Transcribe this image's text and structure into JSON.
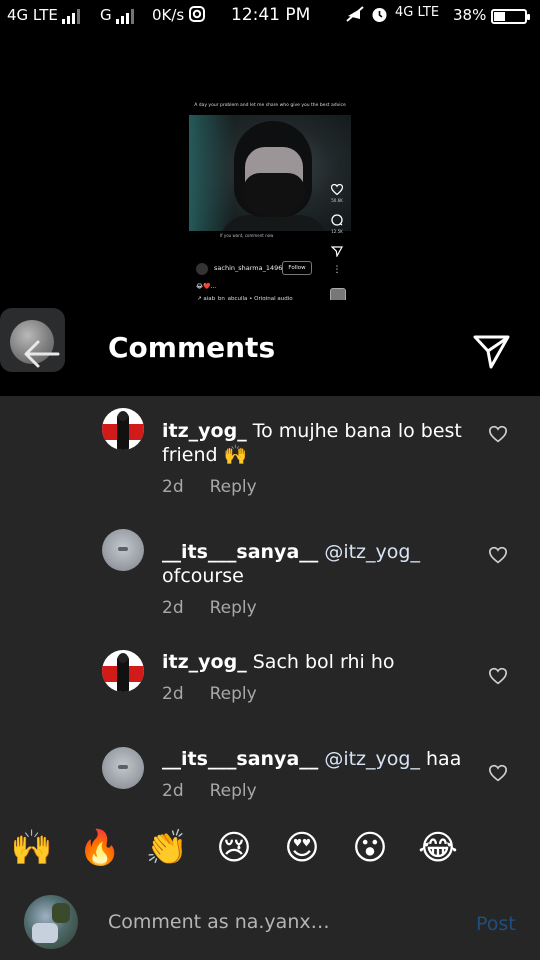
{
  "status_bar": {
    "network_left": "4G LTE",
    "network_g": "G",
    "speed": "0K/s",
    "time": "12:41 PM",
    "network_right": "4G LTE",
    "battery_percent": "38%",
    "battery_level": 0.38
  },
  "reel": {
    "caption_top": "A day your problem and let me share who give you the best advice",
    "subtitle": "If you want, comment now",
    "like_count": "50.6K",
    "comment_count": "12.5K",
    "username": "sachin_sharma_1496",
    "follow_label": "Follow",
    "emoji_line": "😂❤️...",
    "audio_line": "↗ ajab_bn_abculla • Original audio"
  },
  "header": {
    "title": "Comments"
  },
  "comments": [
    {
      "username": "itz_yog_",
      "mention": "",
      "text": "To mujhe bana lo best friend 🙌",
      "time": "2d",
      "reply_label": "Reply",
      "avatar": "yog"
    },
    {
      "username": "__its___sanya__",
      "mention": "@itz_yog_",
      "text": "ofcourse",
      "time": "2d",
      "reply_label": "Reply",
      "avatar": "sanya"
    },
    {
      "username": "itz_yog_",
      "mention": "",
      "text": "Sach bol rhi ho",
      "time": "2d",
      "reply_label": "Reply",
      "avatar": "yog"
    },
    {
      "username": "__its___sanya__",
      "mention": "@itz_yog_",
      "text": "haa",
      "time": "2d",
      "reply_label": "Reply",
      "avatar": "sanya"
    }
  ],
  "emoji_bar": [
    "🙌",
    "🔥",
    "👏",
    "😢",
    "😍",
    "😮",
    "😂"
  ],
  "composer": {
    "placeholder": "Comment as na.yanx…",
    "post_label": "Post"
  },
  "colors": {
    "background": "#000000",
    "sheet": "#262626",
    "meta_text": "#a8a8a8",
    "post_disabled": "#1f4f7d"
  }
}
